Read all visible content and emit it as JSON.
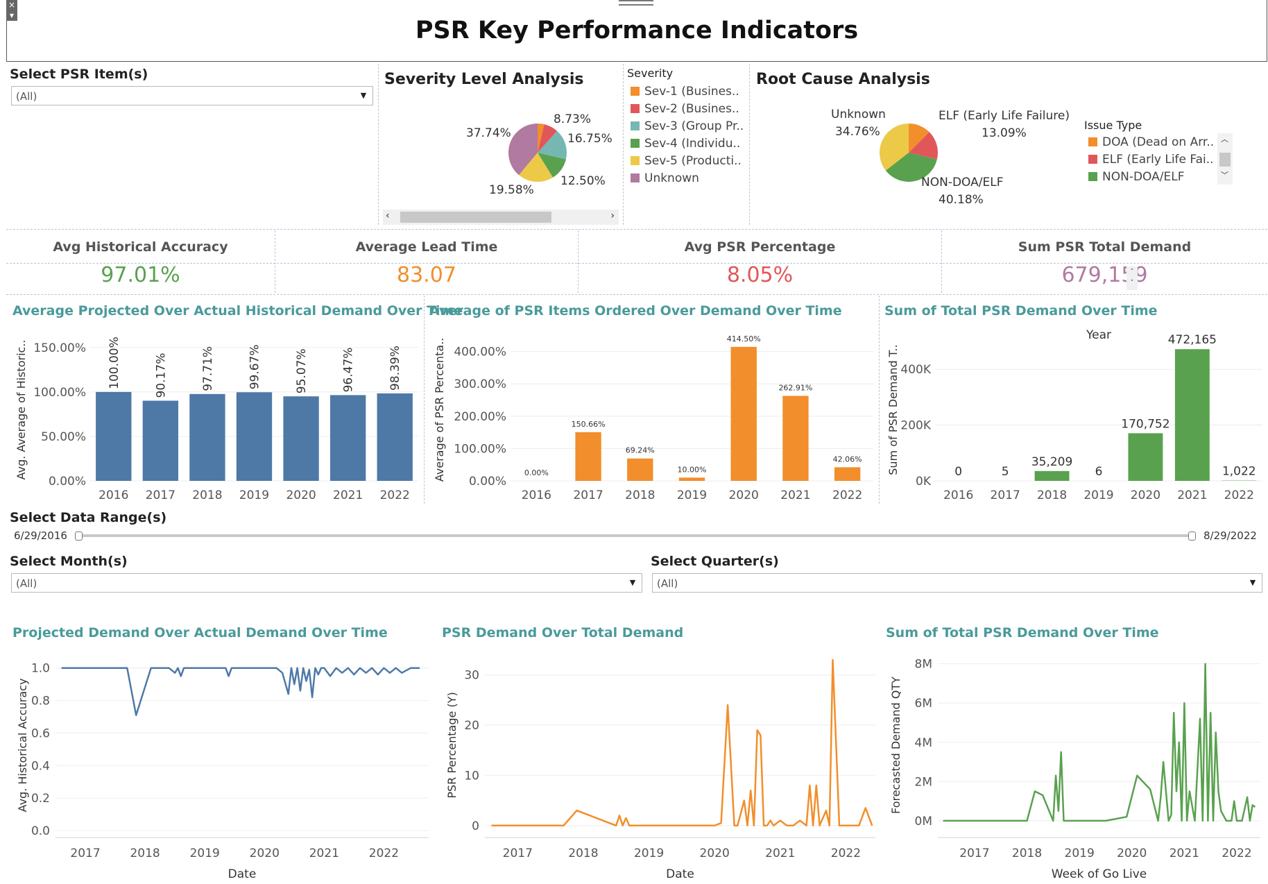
{
  "header": {
    "title": "PSR Key Performance Indicators"
  },
  "filters": {
    "psr_item": {
      "label": "Select PSR Item(s)",
      "value": "(All)"
    },
    "date_range": {
      "label": "Select Data Range(s)",
      "start": "6/29/2016",
      "end": "8/29/2022"
    },
    "month": {
      "label": "Select Month(s)",
      "value": "(All)"
    },
    "quarter": {
      "label": "Select Quarter(s)",
      "value": "(All)"
    }
  },
  "severity": {
    "title": "Severity Level Analysis",
    "legend_title": "Severity",
    "legend": [
      {
        "label": "Sev-1 (Busines..",
        "color": "#f28e2b"
      },
      {
        "label": "Sev-2 (Busines..",
        "color": "#e15759"
      },
      {
        "label": "Sev-3 (Group Pr..",
        "color": "#76b7b2"
      },
      {
        "label": "Sev-4 (Individu..",
        "color": "#59a14f"
      },
      {
        "label": "Sev-5 (Producti..",
        "color": "#edc948"
      },
      {
        "label": "Unknown",
        "color": "#b07aa1"
      }
    ],
    "slice_labels": [
      "8.73%",
      "16.75%",
      "12.50%",
      "19.58%",
      "37.74%"
    ]
  },
  "root_cause": {
    "title": "Root Cause Analysis",
    "legend_title": "Issue Type",
    "legend": [
      {
        "label": "DOA (Dead on Arr..",
        "color": "#f28e2b"
      },
      {
        "label": "ELF (Early Life Fai..",
        "color": "#e15759"
      },
      {
        "label": "NON-DOA/ELF",
        "color": "#59a14f"
      }
    ],
    "labels": {
      "unknown_name": "Unknown",
      "unknown_pct": "34.76%",
      "elf_name": "ELF (Early Life Failure)",
      "elf_pct": "13.09%",
      "non_name": "NON-DOA/ELF",
      "non_pct": "40.18%"
    }
  },
  "kpis": [
    {
      "label": "Avg Historical Accuracy",
      "value": "97.01%",
      "color": "#59a14f"
    },
    {
      "label": "Average Lead Time",
      "value": "83.07",
      "color": "#f28e2b"
    },
    {
      "label": "Avg PSR Percentage",
      "value": "8.05%",
      "color": "#e15759"
    },
    {
      "label": "Sum PSR Total Demand",
      "value": "679,159",
      "color": "#b07aa1"
    }
  ],
  "chart_data": [
    {
      "type": "bar",
      "title": "Average Projected Over Actual Historical Demand Over Time",
      "ylabel": "Avg. Average of Historic..",
      "categories": [
        "2016",
        "2017",
        "2018",
        "2019",
        "2020",
        "2021",
        "2022"
      ],
      "values": [
        100.0,
        90.17,
        97.71,
        99.67,
        95.07,
        96.47,
        98.39
      ],
      "value_labels": [
        "100.00%",
        "90.17%",
        "97.71%",
        "99.67%",
        "95.07%",
        "96.47%",
        "98.39%"
      ],
      "yticks": [
        "0.00%",
        "50.00%",
        "100.00%",
        "150.00%"
      ],
      "ylim": [
        0,
        160
      ],
      "color": "#4e79a7"
    },
    {
      "type": "bar",
      "title": "Average of PSR Items Ordered Over Demand Over Time",
      "ylabel": "Average of PSR Percenta..",
      "categories": [
        "2016",
        "2017",
        "2018",
        "2019",
        "2020",
        "2021",
        "2022"
      ],
      "values": [
        0.0,
        150.66,
        69.24,
        10.0,
        414.5,
        262.91,
        42.06
      ],
      "value_labels": [
        "0.00%",
        "150.66%",
        "69.24%",
        "10.00%",
        "414.50%",
        "262.91%",
        "42.06%"
      ],
      "yticks": [
        "0.00%",
        "100.00%",
        "200.00%",
        "300.00%",
        "400.00%"
      ],
      "ylim": [
        0,
        440
      ],
      "color": "#f28e2b"
    },
    {
      "type": "bar",
      "title": "Sum of Total PSR Demand Over Time",
      "header": "Year",
      "ylabel": "Sum of PSR Demand T..",
      "categories": [
        "2016",
        "2017",
        "2018",
        "2019",
        "2020",
        "2021",
        "2022"
      ],
      "values": [
        0,
        5,
        35209,
        6,
        170752,
        472165,
        1022
      ],
      "value_labels": [
        "0",
        "5",
        "35,209",
        "6",
        "170,752",
        "472,165",
        "1,022"
      ],
      "yticks": [
        "0K",
        "200K",
        "400K"
      ],
      "ylim": [
        0,
        510000
      ],
      "color": "#59a14f"
    },
    {
      "type": "line",
      "title": "Projected Demand Over Actual Demand Over Time",
      "xlabel": "Date",
      "ylabel": "Avg. Historical Accuracy",
      "xticks": [
        "2017",
        "2018",
        "2019",
        "2020",
        "2021",
        "2022"
      ],
      "yticks": [
        "0.0",
        "0.2",
        "0.4",
        "0.6",
        "0.8",
        "1.0"
      ],
      "xlim": [
        2016.5,
        2022.75
      ],
      "ylim": [
        0,
        1.05
      ],
      "color": "#4e79a7",
      "x": [
        2016.6,
        2017.7,
        2017.85,
        2018.1,
        2018.4,
        2018.5,
        2018.55,
        2018.6,
        2018.65,
        2019.2,
        2019.35,
        2019.4,
        2019.45,
        2019.8,
        2020.2,
        2020.3,
        2020.4,
        2020.45,
        2020.5,
        2020.55,
        2020.6,
        2020.65,
        2020.7,
        2020.75,
        2020.8,
        2020.85,
        2020.9,
        2020.95,
        2021.0,
        2021.1,
        2021.2,
        2021.3,
        2021.4,
        2021.5,
        2021.6,
        2021.7,
        2021.8,
        2021.9,
        2022.0,
        2022.1,
        2022.2,
        2022.3,
        2022.45,
        2022.6
      ],
      "y": [
        1.0,
        1.0,
        0.71,
        1.0,
        1.0,
        0.97,
        1.0,
        0.95,
        1.0,
        1.0,
        1.0,
        0.95,
        1.0,
        1.0,
        1.0,
        0.97,
        0.84,
        1.0,
        0.9,
        1.0,
        0.86,
        1.0,
        0.92,
        0.99,
        0.82,
        1.0,
        0.96,
        1.0,
        1.0,
        0.95,
        1.0,
        0.97,
        1.0,
        0.96,
        1.0,
        0.97,
        1.0,
        0.96,
        1.0,
        0.97,
        1.0,
        0.97,
        1.0,
        1.0
      ]
    },
    {
      "type": "line",
      "title": "PSR Demand Over Total Demand",
      "xlabel": "Date",
      "ylabel": "PSR Percentage (Y)",
      "xticks": [
        "2017",
        "2018",
        "2019",
        "2020",
        "2021",
        "2022"
      ],
      "yticks": [
        "0",
        "10",
        "20",
        "30"
      ],
      "xlim": [
        2016.5,
        2022.45
      ],
      "ylim": [
        -1,
        33
      ],
      "color": "#f28e2b",
      "x": [
        2016.6,
        2017.5,
        2017.7,
        2017.9,
        2018.5,
        2018.55,
        2018.6,
        2018.65,
        2018.7,
        2019.5,
        2019.55,
        2019.6,
        2019.85,
        2020.0,
        2020.1,
        2020.2,
        2020.3,
        2020.35,
        2020.45,
        2020.5,
        2020.55,
        2020.6,
        2020.65,
        2020.7,
        2020.75,
        2020.8,
        2020.85,
        2020.9,
        2021.0,
        2021.1,
        2021.2,
        2021.3,
        2021.4,
        2021.45,
        2021.5,
        2021.55,
        2021.6,
        2021.7,
        2021.75,
        2021.8,
        2021.9,
        2022.0,
        2022.1,
        2022.2,
        2022.3,
        2022.4
      ],
      "y": [
        0,
        0,
        0,
        3,
        0,
        2,
        0,
        1.5,
        0,
        0,
        0,
        0,
        0,
        0,
        0.5,
        24,
        0,
        0,
        5,
        0,
        7,
        0,
        19,
        18,
        0,
        0,
        1,
        0,
        1,
        0,
        0,
        1,
        0,
        8,
        0,
        8,
        0,
        3,
        0,
        33,
        0,
        0,
        0,
        0,
        3.5,
        0
      ]
    },
    {
      "type": "line",
      "title": "Sum of Total PSR Demand Over Time",
      "xlabel": "Week of Go Live",
      "ylabel": "Forecasted Demand QTY",
      "xticks": [
        "2017",
        "2018",
        "2019",
        "2020",
        "2021",
        "2022"
      ],
      "yticks": [
        "0M",
        "2M",
        "4M",
        "6M",
        "8M"
      ],
      "xlim": [
        2016.3,
        2022.45
      ],
      "ylim": [
        -0.5,
        8.2
      ],
      "color": "#59a14f",
      "x": [
        2016.4,
        2018.0,
        2018.15,
        2018.3,
        2018.5,
        2018.55,
        2018.6,
        2018.65,
        2018.7,
        2019.0,
        2019.5,
        2019.9,
        2020.1,
        2020.35,
        2020.5,
        2020.55,
        2020.6,
        2020.65,
        2020.7,
        2020.75,
        2020.8,
        2020.85,
        2020.9,
        2020.95,
        2021.0,
        2021.05,
        2021.1,
        2021.2,
        2021.3,
        2021.35,
        2021.4,
        2021.45,
        2021.5,
        2021.55,
        2021.6,
        2021.65,
        2021.7,
        2021.8,
        2021.9,
        2021.95,
        2022.0,
        2022.1,
        2022.2,
        2022.25,
        2022.3,
        2022.35
      ],
      "y": [
        0,
        0,
        1.5,
        1.3,
        0,
        2.3,
        0.5,
        3.5,
        0,
        0,
        0,
        0.2,
        2.3,
        1.6,
        0,
        1.2,
        3,
        1.5,
        0,
        0.3,
        5.5,
        1.5,
        4,
        0,
        6.0,
        0,
        1.5,
        0,
        5.2,
        0,
        8.0,
        0,
        5.5,
        0,
        4.5,
        1.5,
        0.5,
        0,
        0,
        1.0,
        0,
        0,
        1.2,
        0,
        0.8,
        0.7
      ]
    }
  ]
}
